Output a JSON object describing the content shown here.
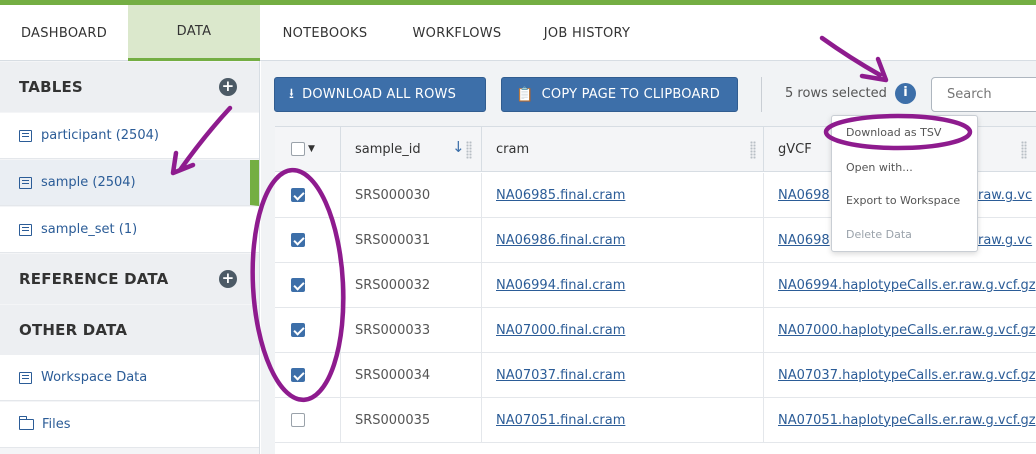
{
  "tabs": [
    {
      "label": "DASHBOARD"
    },
    {
      "label": "DATA"
    },
    {
      "label": "NOTEBOOKS"
    },
    {
      "label": "WORKFLOWS"
    },
    {
      "label": "JOB HISTORY"
    }
  ],
  "sidebar": {
    "tables_header": "TABLES",
    "tables": [
      {
        "label": "participant (2504)"
      },
      {
        "label": "sample (2504)"
      },
      {
        "label": "sample_set (1)"
      }
    ],
    "reference_header": "REFERENCE DATA",
    "other_header": "OTHER DATA",
    "other_items": [
      {
        "label": "Workspace Data"
      },
      {
        "label": "Files"
      }
    ]
  },
  "toolbar": {
    "download_all": "DOWNLOAD ALL ROWS",
    "copy_page": "COPY PAGE TO CLIPBOARD",
    "rows_selected": "5 rows selected",
    "search_placeholder": "Search"
  },
  "table": {
    "columns": [
      "sample_id",
      "cram",
      "gVCF"
    ],
    "rows": [
      {
        "checked": true,
        "sample_id": "SRS000030",
        "cram": "NA06985.final.cram",
        "gvcf": "NA0698"
      },
      {
        "checked": true,
        "sample_id": "SRS000031",
        "cram": "NA06986.final.cram",
        "gvcf": "NA0698"
      },
      {
        "checked": true,
        "sample_id": "SRS000032",
        "cram": "NA06994.final.cram",
        "gvcf": "NA06994.haplotypeCalls.er.raw.g.vcf.gz"
      },
      {
        "checked": true,
        "sample_id": "SRS000033",
        "cram": "NA07000.final.cram",
        "gvcf": "NA07000.haplotypeCalls.er.raw.g.vcf.gz"
      },
      {
        "checked": true,
        "sample_id": "SRS000034",
        "cram": "NA07037.final.cram",
        "gvcf": "NA07037.haplotypeCalls.er.raw.g.vcf.gz"
      },
      {
        "checked": false,
        "sample_id": "SRS000035",
        "cram": "NA07051.final.cram",
        "gvcf": "NA07051.haplotypeCalls.er.raw.g.vcf.gz"
      }
    ],
    "gvcf_suffix_rows01": "raw.g.vc"
  },
  "menu": {
    "items": [
      {
        "label": "Download as TSV",
        "disabled": false
      },
      {
        "label": "Open with...",
        "disabled": false
      },
      {
        "label": "Export to Workspace",
        "disabled": false
      },
      {
        "label": "Delete Data",
        "disabled": true
      }
    ]
  },
  "icons": {
    "plus": "plus-circle-icon",
    "table": "table-icon",
    "folder": "folder-icon",
    "download": "download-icon",
    "clipboard": "clipboard-icon",
    "info": "info-icon",
    "sort": "sort-arrow-icon"
  },
  "colors": {
    "accent_green": "#74ae43",
    "primary_blue": "#3d6fa9",
    "annotation_purple": "#8e1b8e"
  }
}
